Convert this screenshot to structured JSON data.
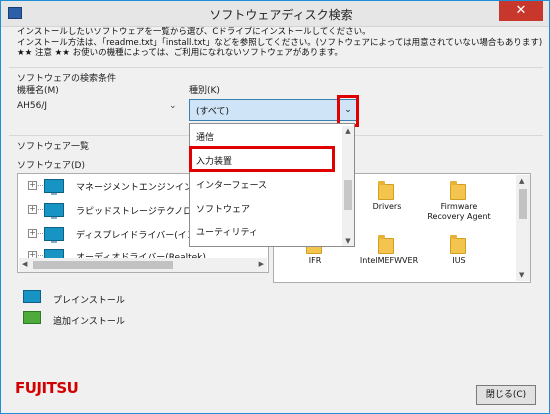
{
  "window": {
    "title": "ソフトウェアディスク検索",
    "close_symbol": "✕"
  },
  "notes": [
    "インストールしたいソフトウェアを一覧から選び、Cドライブにインストールしてください。",
    "インストール方法は、「readme.txt」「install.txt」などを参照してください。(ソフトウェアによっては用意されていない場合もあります)",
    "★★ 注意 ★★ お使いの機種によっては、ご利用になれないソフトウェアがあります。"
  ],
  "search": {
    "section_label": "ソフトウェアの検索条件",
    "model_label": "機種名(M)",
    "model_value": "AH56/J",
    "type_label": "種別(K)",
    "type_value": "(すべて)",
    "type_options": [
      "通信",
      "入力装置",
      "インターフェース",
      "ソフトウェア",
      "ユーティリティ"
    ]
  },
  "software_list": {
    "section_label": "ソフトウェア一覧",
    "tree_label": "ソフトウェア(D)",
    "items": [
      "マネージメントエンジンインターフ",
      "ラピッドストレージテクノロジー(イ",
      "ディスプレイドライバー(インテル",
      "オーディオドライバー(Realtek)"
    ]
  },
  "files": [
    {
      "name": "Drivers"
    },
    {
      "name": "Firmware Recovery Agent"
    },
    {
      "name": "IFR"
    },
    {
      "name": "IntelMEFWVER"
    },
    {
      "name": "IUS"
    }
  ],
  "legend": [
    {
      "label": "プレインストール",
      "color": "#1794c4"
    },
    {
      "label": "追加インストール",
      "color": "#4faa3c"
    }
  ],
  "brand": "FUJITSU",
  "close_button_label": "閉じる(C)",
  "colors": {
    "accent": "#1e8ed6",
    "highlight": "#e10000",
    "brand": "#d20000"
  }
}
